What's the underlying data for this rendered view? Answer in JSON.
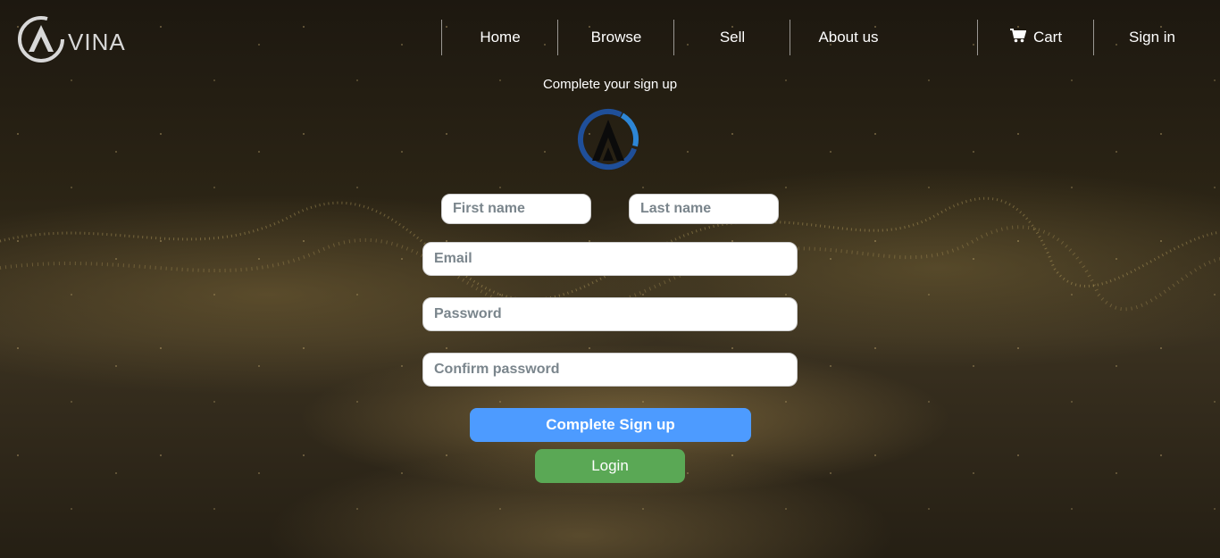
{
  "brand": {
    "name": "VINA"
  },
  "nav": {
    "home": "Home",
    "browse": "Browse",
    "sell": "Sell",
    "about": "About us",
    "cart": "Cart",
    "cart_icon": "shopping-cart-icon",
    "signin": "Sign in"
  },
  "form": {
    "heading": "Complete your sign up",
    "first_name_placeholder": "First name",
    "last_name_placeholder": "Last name",
    "email_placeholder": "Email",
    "password_placeholder": "Password",
    "confirm_password_placeholder": "Confirm password",
    "submit_label": "Complete Sign up",
    "login_label": "Login"
  },
  "colors": {
    "signup_button": "#4d9bff",
    "login_button": "#5aa855",
    "logo_blue": "#1f6fc0"
  }
}
